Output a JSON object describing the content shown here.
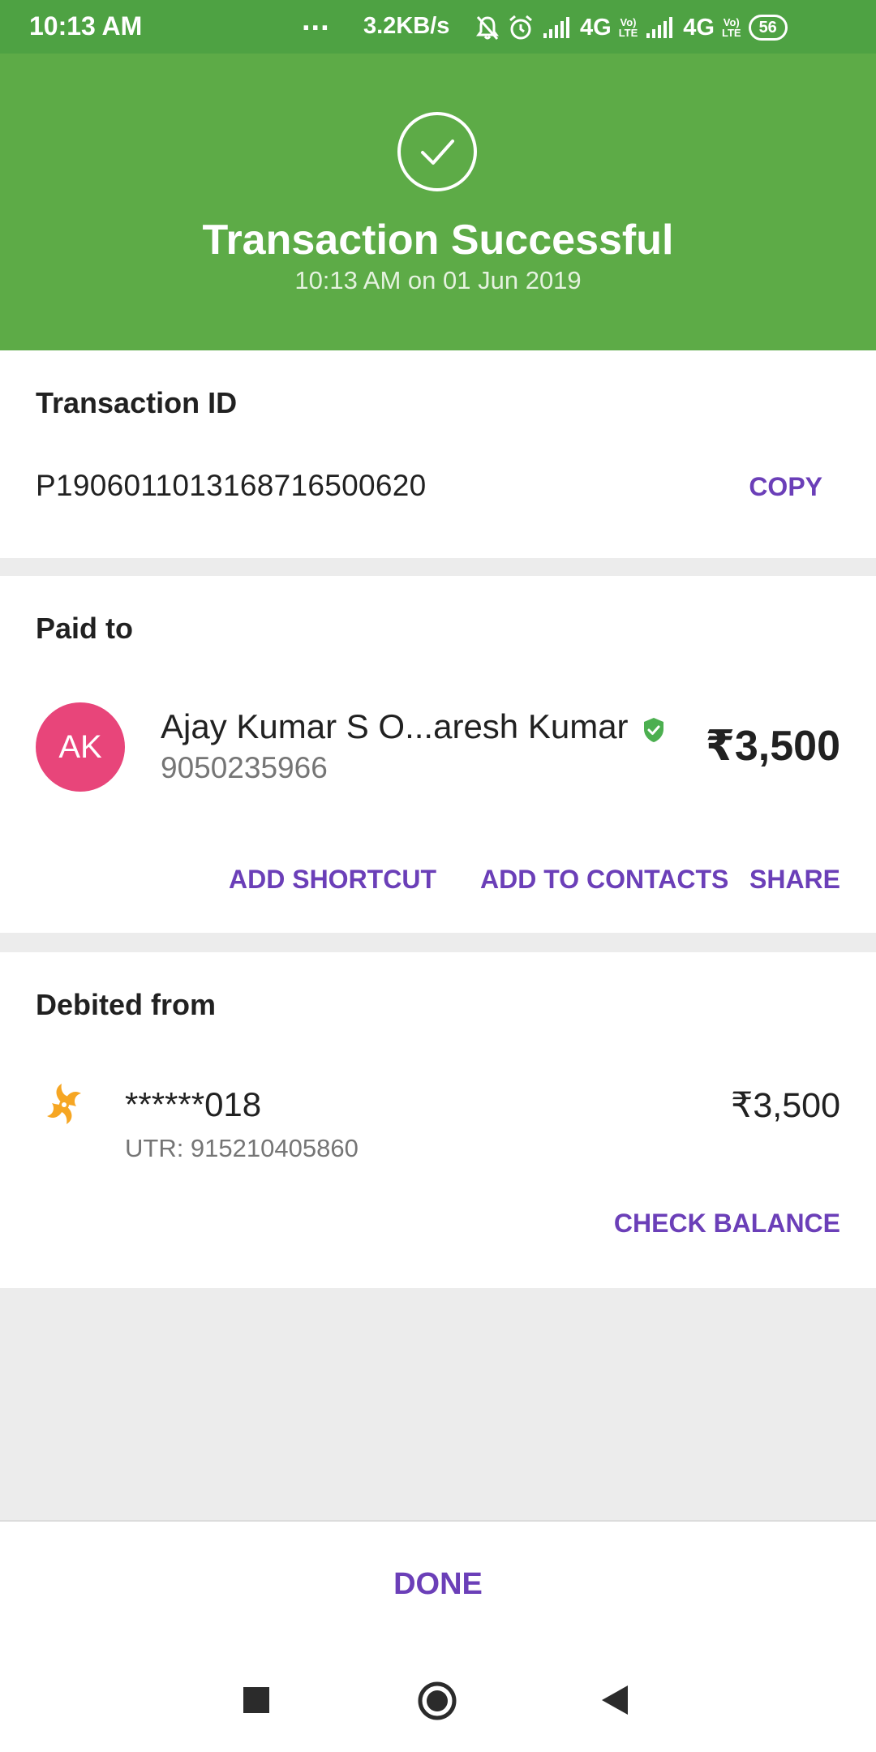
{
  "status_bar": {
    "time": "10:13 AM",
    "dots": "...",
    "net_speed": "3.2KB/s",
    "network1": "4G",
    "network2": "4G",
    "volte_top": "Vo)",
    "volte_bottom": "LTE",
    "battery": "56",
    "icons": [
      "mute-icon",
      "alarm-icon",
      "signal-icon",
      "signal-icon"
    ]
  },
  "header": {
    "title": "Transaction Successful",
    "subtitle": "10:13 AM on 01 Jun 2019",
    "icon": "check-circle-icon",
    "color": "#5dab47"
  },
  "transaction": {
    "label": "Transaction ID",
    "id": "P1906011013168716500620",
    "copy_label": "COPY"
  },
  "paid_to": {
    "label": "Paid to",
    "avatar_initials": "AK",
    "avatar_color": "#e8457a",
    "name": "Ajay Kumar S O...aresh Kumar",
    "verified_icon": "verified-shield-icon",
    "phone": "9050235966",
    "amount": "₹3,500",
    "actions": {
      "add_shortcut": "ADD SHORTCUT",
      "add_to_contacts": "ADD TO CONTACTS",
      "share": "SHARE"
    }
  },
  "debited_from": {
    "label": "Debited from",
    "bank_icon": "bank-logo-icon",
    "account": "******018",
    "utr": "UTR: 915210405860",
    "amount": "₹3,500",
    "check_balance": "CHECK BALANCE"
  },
  "footer": {
    "done_label": "DONE",
    "accent_color": "#6b3fb8"
  },
  "nav": {
    "icons": [
      "recents-icon",
      "home-icon",
      "back-icon"
    ]
  }
}
